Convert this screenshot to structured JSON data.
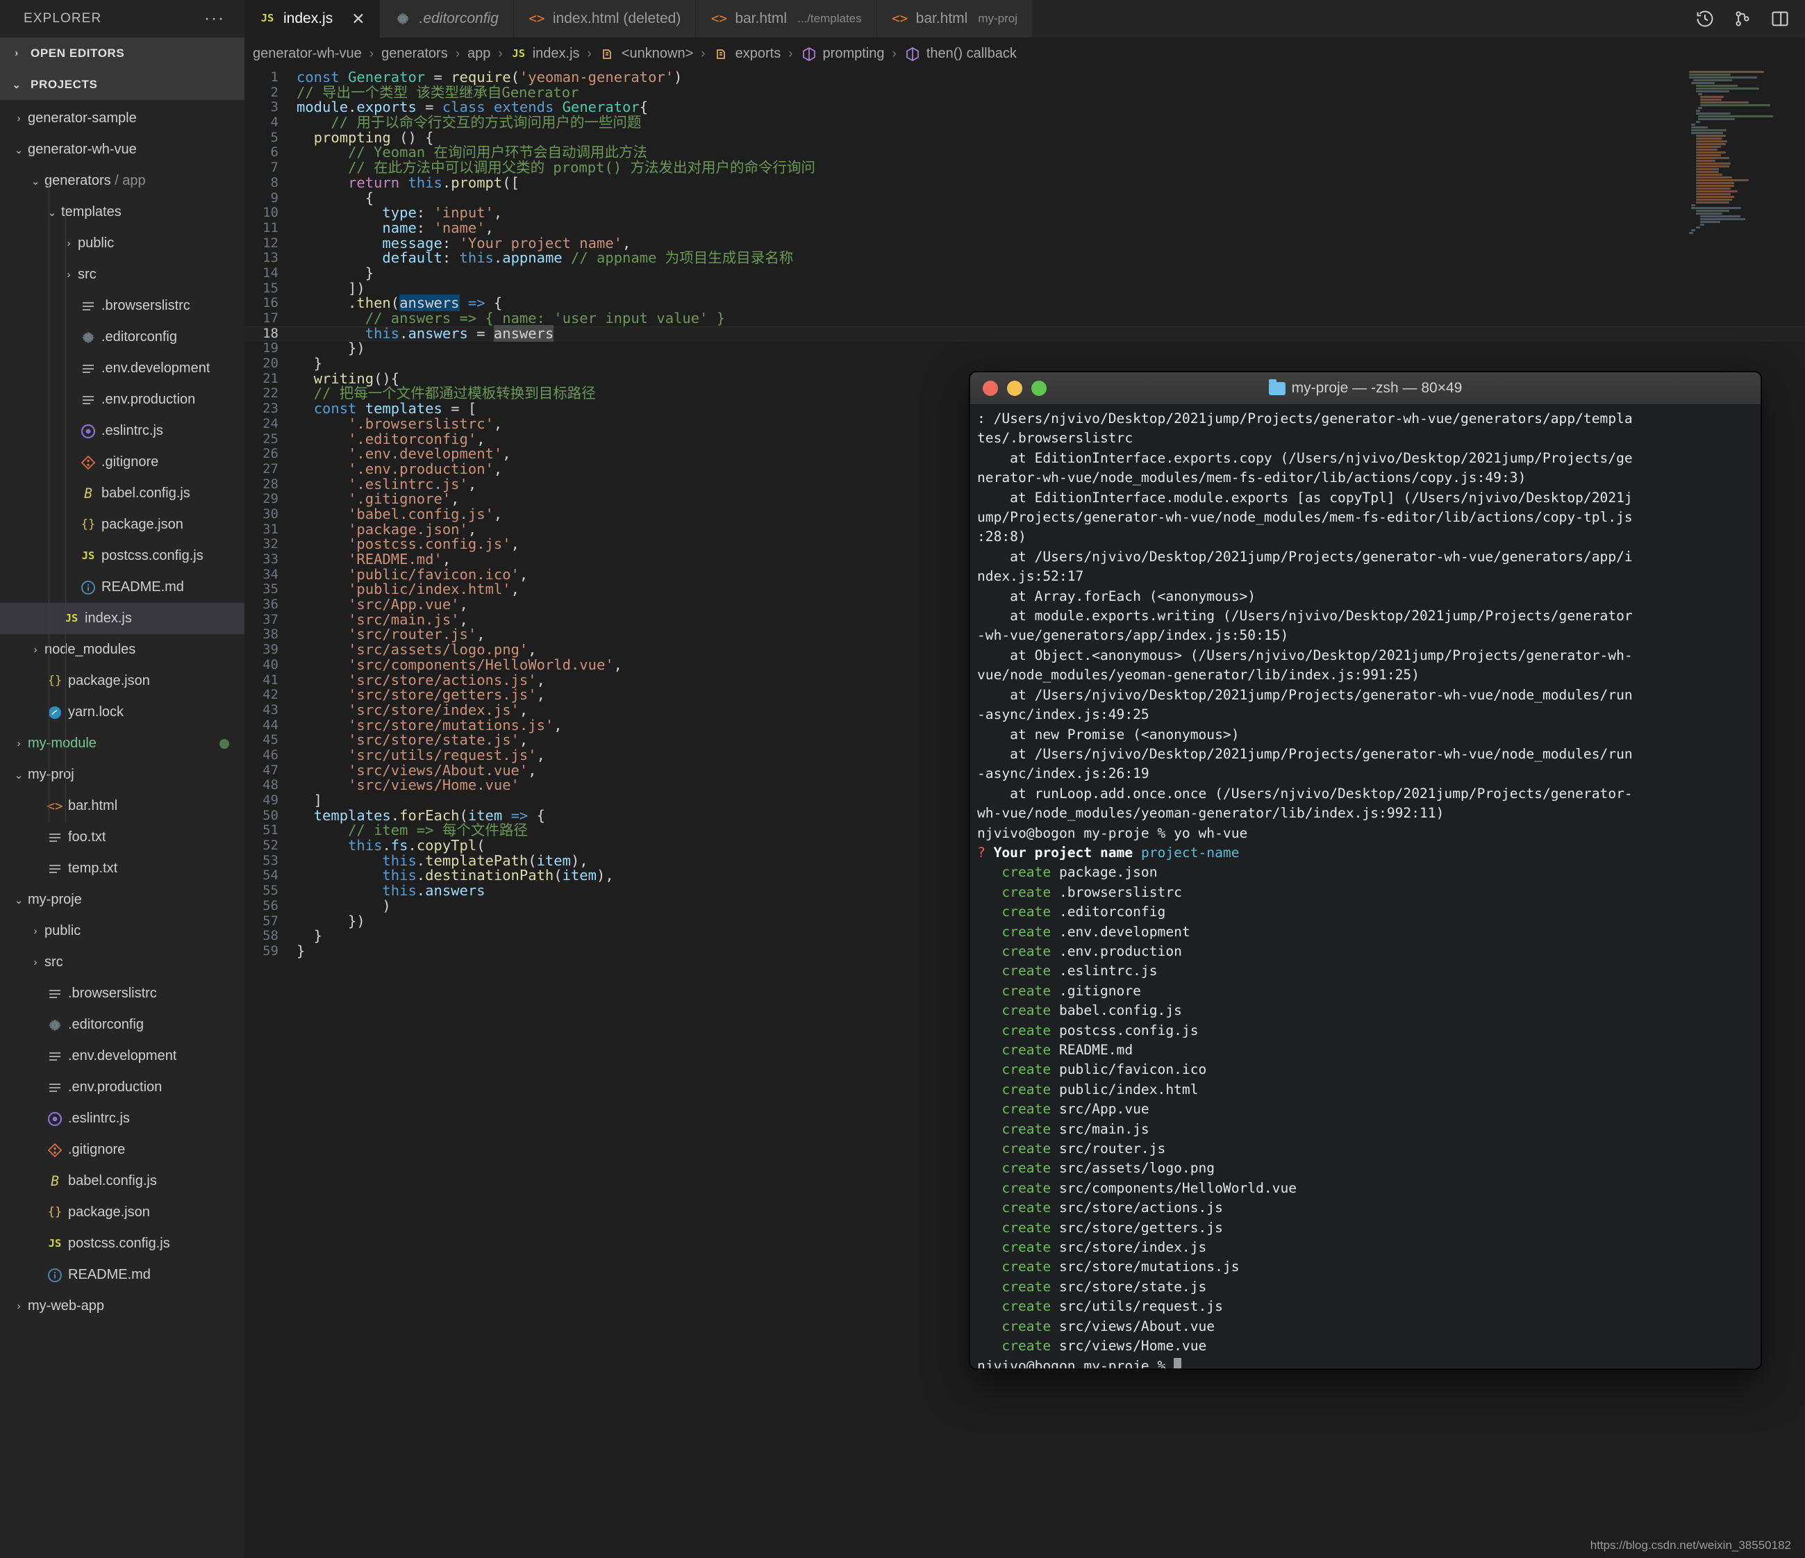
{
  "sidebar": {
    "title": "EXPLORER",
    "more_icon": "ellipsis-icon",
    "sections": [
      {
        "label": "OPEN EDITORS",
        "expanded": false
      },
      {
        "label": "PROJECTS",
        "expanded": true
      }
    ],
    "tree": [
      {
        "label": "generator-sample",
        "indent": 1,
        "twisty": "collapsed",
        "icon": "",
        "selected": false
      },
      {
        "label": "generator-wh-vue",
        "indent": 1,
        "twisty": "expanded",
        "icon": "",
        "selected": false
      },
      {
        "label": "generators",
        "suffix": "/ app",
        "indent": 2,
        "twisty": "expanded",
        "icon": "",
        "selected": false
      },
      {
        "label": "templates",
        "indent": 3,
        "twisty": "expanded",
        "icon": "",
        "selected": false
      },
      {
        "label": "public",
        "indent": 4,
        "twisty": "collapsed",
        "icon": "",
        "selected": false
      },
      {
        "label": "src",
        "indent": 4,
        "twisty": "collapsed",
        "icon": "",
        "selected": false
      },
      {
        "label": ".browserslistrc",
        "indent": 4,
        "twisty": "none",
        "icon": "lines-icon",
        "selected": false
      },
      {
        "label": ".editorconfig",
        "indent": 4,
        "twisty": "none",
        "icon": "gear-icon",
        "selected": false
      },
      {
        "label": ".env.development",
        "indent": 4,
        "twisty": "none",
        "icon": "lines-icon",
        "selected": false
      },
      {
        "label": ".env.production",
        "indent": 4,
        "twisty": "none",
        "icon": "lines-icon",
        "selected": false
      },
      {
        "label": ".eslintrc.js",
        "indent": 4,
        "twisty": "none",
        "icon": "eslint-icon",
        "selected": false
      },
      {
        "label": ".gitignore",
        "indent": 4,
        "twisty": "none",
        "icon": "git-icon",
        "selected": false
      },
      {
        "label": "babel.config.js",
        "indent": 4,
        "twisty": "none",
        "icon": "babel-icon",
        "selected": false
      },
      {
        "label": "package.json",
        "indent": 4,
        "twisty": "none",
        "icon": "json-icon",
        "selected": false
      },
      {
        "label": "postcss.config.js",
        "indent": 4,
        "twisty": "none",
        "icon": "js-icon",
        "selected": false
      },
      {
        "label": "README.md",
        "indent": 4,
        "twisty": "none",
        "icon": "info-icon",
        "selected": false
      },
      {
        "label": "index.js",
        "indent": 3,
        "twisty": "none",
        "icon": "js-icon",
        "selected": true
      },
      {
        "label": "node_modules",
        "indent": 2,
        "twisty": "collapsed",
        "icon": "",
        "selected": false
      },
      {
        "label": "package.json",
        "indent": 2,
        "twisty": "none",
        "icon": "json-icon",
        "selected": false
      },
      {
        "label": "yarn.lock",
        "indent": 2,
        "twisty": "none",
        "icon": "yarn-icon",
        "selected": false
      },
      {
        "label": "my-module",
        "indent": 1,
        "twisty": "collapsed",
        "icon": "",
        "selected": false,
        "green": true,
        "dot": true
      },
      {
        "label": "my-proj",
        "indent": 1,
        "twisty": "expanded",
        "icon": "",
        "selected": false
      },
      {
        "label": "bar.html",
        "indent": 2,
        "twisty": "none",
        "icon": "html-icon",
        "selected": false
      },
      {
        "label": "foo.txt",
        "indent": 2,
        "twisty": "none",
        "icon": "lines-icon",
        "selected": false
      },
      {
        "label": "temp.txt",
        "indent": 2,
        "twisty": "none",
        "icon": "lines-icon",
        "selected": false
      },
      {
        "label": "my-proje",
        "indent": 1,
        "twisty": "expanded",
        "icon": "",
        "selected": false
      },
      {
        "label": "public",
        "indent": 2,
        "twisty": "collapsed",
        "icon": "",
        "selected": false
      },
      {
        "label": "src",
        "indent": 2,
        "twisty": "collapsed",
        "icon": "",
        "selected": false
      },
      {
        "label": ".browserslistrc",
        "indent": 2,
        "twisty": "none",
        "icon": "lines-icon",
        "selected": false
      },
      {
        "label": ".editorconfig",
        "indent": 2,
        "twisty": "none",
        "icon": "gear-icon",
        "selected": false
      },
      {
        "label": ".env.development",
        "indent": 2,
        "twisty": "none",
        "icon": "lines-icon",
        "selected": false
      },
      {
        "label": ".env.production",
        "indent": 2,
        "twisty": "none",
        "icon": "lines-icon",
        "selected": false
      },
      {
        "label": ".eslintrc.js",
        "indent": 2,
        "twisty": "none",
        "icon": "eslint-icon",
        "selected": false
      },
      {
        "label": ".gitignore",
        "indent": 2,
        "twisty": "none",
        "icon": "git-icon",
        "selected": false
      },
      {
        "label": "babel.config.js",
        "indent": 2,
        "twisty": "none",
        "icon": "babel-icon",
        "selected": false
      },
      {
        "label": "package.json",
        "indent": 2,
        "twisty": "none",
        "icon": "json-icon",
        "selected": false
      },
      {
        "label": "postcss.config.js",
        "indent": 2,
        "twisty": "none",
        "icon": "js-icon",
        "selected": false
      },
      {
        "label": "README.md",
        "indent": 2,
        "twisty": "none",
        "icon": "info-icon",
        "selected": false
      },
      {
        "label": "my-web-app",
        "indent": 1,
        "twisty": "collapsed",
        "icon": "",
        "selected": false
      }
    ]
  },
  "tabs": [
    {
      "label": "index.js",
      "icon": "js-icon",
      "active": true,
      "closable": true,
      "italic": false,
      "sub": ""
    },
    {
      "label": ".editorconfig",
      "icon": "gear-icon",
      "active": false,
      "closable": false,
      "italic": true,
      "sub": ""
    },
    {
      "label": "index.html (deleted)",
      "icon": "html-icon",
      "active": false,
      "closable": false,
      "italic": false,
      "sub": ""
    },
    {
      "label": "bar.html",
      "icon": "html-icon",
      "active": false,
      "closable": false,
      "italic": false,
      "sub": ".../templates"
    },
    {
      "label": "bar.html",
      "icon": "html-icon",
      "active": false,
      "closable": false,
      "italic": false,
      "sub": "my-proj"
    }
  ],
  "tab_actions": [
    {
      "name": "history-icon"
    },
    {
      "name": "source-control-icon"
    },
    {
      "name": "split-editor-icon"
    }
  ],
  "breadcrumb": [
    {
      "label": "generator-wh-vue",
      "icon": ""
    },
    {
      "label": "generators",
      "icon": ""
    },
    {
      "label": "app",
      "icon": ""
    },
    {
      "label": "index.js",
      "icon": "js-icon"
    },
    {
      "label": "<unknown>",
      "icon": "field-icon"
    },
    {
      "label": "exports",
      "icon": "field-icon"
    },
    {
      "label": "prompting",
      "icon": "method-icon"
    },
    {
      "label": "then() callback",
      "icon": "method-icon"
    }
  ],
  "editor": {
    "current_line": 18,
    "lines": [
      {
        "n": 1,
        "html": "<span class=\"k\">const</span> <span class=\"typ\">Generator</span> <span class=\"eq\">=</span> <span class=\"fn\">require</span>(<span class=\"str\">'yeoman-generator'</span>)"
      },
      {
        "n": 2,
        "html": "<span class=\"cm\">// 导出一个类型 该类型继承自Generator</span>"
      },
      {
        "n": 3,
        "html": "<span class=\"var\">module</span>.<span class=\"prop\">exports</span> <span class=\"eq\">=</span> <span class=\"k\">class</span> <span class=\"k\">extends</span> <span class=\"typ\">Generator</span>{"
      },
      {
        "n": 4,
        "html": "    <span class=\"cm\">// 用于以命令行交互的方式询问用户的一些问题</span>"
      },
      {
        "n": 5,
        "html": "  <span class=\"fn\">prompting</span> () {"
      },
      {
        "n": 6,
        "html": "      <span class=\"cm\">// Yeoman 在询问用户环节会自动调用此方法</span>"
      },
      {
        "n": 7,
        "html": "      <span class=\"cm\">// 在此方法中可以调用父类的 prompt() 方法发出对用户的命令行询问</span>"
      },
      {
        "n": 8,
        "html": "      <span class=\"kc\">return</span> <span class=\"k\">this</span>.<span class=\"fn\">prompt</span>(["
      },
      {
        "n": 9,
        "html": "        {"
      },
      {
        "n": 10,
        "html": "          <span class=\"var\">type</span>: <span class=\"str\">'input'</span>,"
      },
      {
        "n": 11,
        "html": "          <span class=\"var\">name</span>: <span class=\"str\">'name'</span>,"
      },
      {
        "n": 12,
        "html": "          <span class=\"var\">message</span>: <span class=\"str\">'Your project name'</span>,"
      },
      {
        "n": 13,
        "html": "          <span class=\"var\">default</span>: <span class=\"k\">this</span>.<span class=\"prop\">appname</span> <span class=\"cm\">// appname 为项目生成目录名称</span>"
      },
      {
        "n": 14,
        "html": "        }"
      },
      {
        "n": 15,
        "html": "      ])"
      },
      {
        "n": 16,
        "html": "      .<span class=\"fn\">then</span>(<span class=\"sel\">answers</span> <span class=\"k\">=&gt;</span> {"
      },
      {
        "n": 17,
        "html": "        <span class=\"cm\">// answers =&gt; { name: 'user input value' }</span>"
      },
      {
        "n": 18,
        "html": "        <span class=\"k\">this</span>.<span class=\"prop\">answers</span> <span class=\"eq\">=</span> <span class=\"wordhl\">answers</span>"
      },
      {
        "n": 19,
        "html": "      })"
      },
      {
        "n": 20,
        "html": "  }"
      },
      {
        "n": 21,
        "html": "  <span class=\"fn\">writing</span>(){"
      },
      {
        "n": 22,
        "html": "  <span class=\"cm\">// 把每一个文件都通过模板转换到目标路径</span>"
      },
      {
        "n": 23,
        "html": "  <span class=\"k\">const</span> <span class=\"var\">templates</span> <span class=\"eq\">=</span> ["
      },
      {
        "n": 24,
        "html": "      <span class=\"str\">'.browserslistrc'</span>,"
      },
      {
        "n": 25,
        "html": "      <span class=\"str\">'.editorconfig'</span>,"
      },
      {
        "n": 26,
        "html": "      <span class=\"str\">'.env.development'</span>,"
      },
      {
        "n": 27,
        "html": "      <span class=\"str\">'.env.production'</span>,"
      },
      {
        "n": 28,
        "html": "      <span class=\"str\">'.eslintrc.js'</span>,"
      },
      {
        "n": 29,
        "html": "      <span class=\"str\">'.gitignore'</span>,"
      },
      {
        "n": 30,
        "html": "      <span class=\"str\">'babel.config.js'</span>,"
      },
      {
        "n": 31,
        "html": "      <span class=\"str\">'package.json'</span>,"
      },
      {
        "n": 32,
        "html": "      <span class=\"str\">'postcss.config.js'</span>,"
      },
      {
        "n": 33,
        "html": "      <span class=\"str\">'README.md'</span>,"
      },
      {
        "n": 34,
        "html": "      <span class=\"str\">'public/favicon.ico'</span>,"
      },
      {
        "n": 35,
        "html": "      <span class=\"str\">'public/index.html'</span>,"
      },
      {
        "n": 36,
        "html": "      <span class=\"str\">'src/App.vue'</span>,"
      },
      {
        "n": 37,
        "html": "      <span class=\"str\">'src/main.js'</span>,"
      },
      {
        "n": 38,
        "html": "      <span class=\"str\">'src/router.js'</span>,"
      },
      {
        "n": 39,
        "html": "      <span class=\"str\">'src/assets/logo.png'</span>,"
      },
      {
        "n": 40,
        "html": "      <span class=\"str\">'src/components/HelloWorld.vue'</span>,"
      },
      {
        "n": 41,
        "html": "      <span class=\"str\">'src/store/actions.js'</span>,"
      },
      {
        "n": 42,
        "html": "      <span class=\"str\">'src/store/getters.js'</span>,"
      },
      {
        "n": 43,
        "html": "      <span class=\"str\">'src/store/index.js'</span>,"
      },
      {
        "n": 44,
        "html": "      <span class=\"str\">'src/store/mutations.js'</span>,"
      },
      {
        "n": 45,
        "html": "      <span class=\"str\">'src/store/state.js'</span>,"
      },
      {
        "n": 46,
        "html": "      <span class=\"str\">'src/utils/request.js'</span>,"
      },
      {
        "n": 47,
        "html": "      <span class=\"str\">'src/views/About.vue'</span>,"
      },
      {
        "n": 48,
        "html": "      <span class=\"str\">'src/views/Home.vue'</span>"
      },
      {
        "n": 49,
        "html": "  ]"
      },
      {
        "n": 50,
        "html": "  <span class=\"var\">templates</span>.<span class=\"fn\">forEach</span>(<span class=\"var\">item</span> <span class=\"k\">=&gt;</span> {"
      },
      {
        "n": 51,
        "html": "      <span class=\"cm\">// item =&gt; 每个文件路径</span>"
      },
      {
        "n": 52,
        "html": "      <span class=\"k\">this</span>.<span class=\"prop\">fs</span>.<span class=\"fn\">copyTpl</span>("
      },
      {
        "n": 53,
        "html": "          <span class=\"k\">this</span>.<span class=\"fn\">templatePath</span>(<span class=\"var\">item</span>),"
      },
      {
        "n": 54,
        "html": "          <span class=\"k\">this</span>.<span class=\"fn\">destinationPath</span>(<span class=\"var\">item</span>),"
      },
      {
        "n": 55,
        "html": "          <span class=\"k\">this</span>.<span class=\"prop\">answers</span>"
      },
      {
        "n": 56,
        "html": "          )"
      },
      {
        "n": 57,
        "html": "      })"
      },
      {
        "n": 58,
        "html": "  }"
      },
      {
        "n": 59,
        "html": "}"
      }
    ]
  },
  "terminal": {
    "title": "my-proje — -zsh — 80×49",
    "folder_icon": "folder-icon",
    "traffic_lights": [
      "close-red",
      "minimize-yellow",
      "zoom-green"
    ],
    "body_html": ": /Users/njvivo/Desktop/2021jump/Projects/generator-wh-vue/generators/app/templa\ntes/.browserslistrc\n    at EditionInterface.exports.copy (/Users/njvivo/Desktop/2021jump/Projects/ge\nnerator-wh-vue/node_modules/mem-fs-editor/lib/actions/copy.js:49:3)\n    at EditionInterface.module.exports [as copyTpl] (/Users/njvivo/Desktop/2021j\nump/Projects/generator-wh-vue/node_modules/mem-fs-editor/lib/actions/copy-tpl.js\n:28:8)\n    at /Users/njvivo/Desktop/2021jump/Projects/generator-wh-vue/generators/app/i\nndex.js:52:17\n    at Array.forEach (&lt;anonymous&gt;)\n    at module.exports.writing (/Users/njvivo/Desktop/2021jump/Projects/generator\n-wh-vue/generators/app/index.js:50:15)\n    at Object.&lt;anonymous&gt; (/Users/njvivo/Desktop/2021jump/Projects/generator-wh-\nvue/node_modules/yeoman-generator/lib/index.js:991:25)\n    at /Users/njvivo/Desktop/2021jump/Projects/generator-wh-vue/node_modules/run\n-async/index.js:49:25\n    at new Promise (&lt;anonymous&gt;)\n    at /Users/njvivo/Desktop/2021jump/Projects/generator-wh-vue/node_modules/run\n-async/index.js:26:19\n    at runLoop.add.once.once (/Users/njvivo/Desktop/2021jump/Projects/generator-\nwh-vue/node_modules/yeoman-generator/lib/index.js:992:11)\nnjvivo@bogon my-proje % yo wh-vue\n<span class=\"rd\">?</span> <span class=\"bold\">Your project name</span> <span class=\"cy\">project-name</span>\n   <span class=\"g\">create</span> package.json\n   <span class=\"g\">create</span> .browserslistrc\n   <span class=\"g\">create</span> .editorconfig\n   <span class=\"g\">create</span> .env.development\n   <span class=\"g\">create</span> .env.production\n   <span class=\"g\">create</span> .eslintrc.js\n   <span class=\"g\">create</span> .gitignore\n   <span class=\"g\">create</span> babel.config.js\n   <span class=\"g\">create</span> postcss.config.js\n   <span class=\"g\">create</span> README.md\n   <span class=\"g\">create</span> public/favicon.ico\n   <span class=\"g\">create</span> public/index.html\n   <span class=\"g\">create</span> src/App.vue\n   <span class=\"g\">create</span> src/main.js\n   <span class=\"g\">create</span> src/router.js\n   <span class=\"g\">create</span> src/assets/logo.png\n   <span class=\"g\">create</span> src/components/HelloWorld.vue\n   <span class=\"g\">create</span> src/store/actions.js\n   <span class=\"g\">create</span> src/store/getters.js\n   <span class=\"g\">create</span> src/store/index.js\n   <span class=\"g\">create</span> src/store/mutations.js\n   <span class=\"g\">create</span> src/store/state.js\n   <span class=\"g\">create</span> src/utils/request.js\n   <span class=\"g\">create</span> src/views/About.vue\n   <span class=\"g\">create</span> src/views/Home.vue\nnjvivo@bogon my-proje % <span class=\"cursor\"></span>"
  },
  "watermark": "https://blog.csdn.net/weixin_38550182"
}
